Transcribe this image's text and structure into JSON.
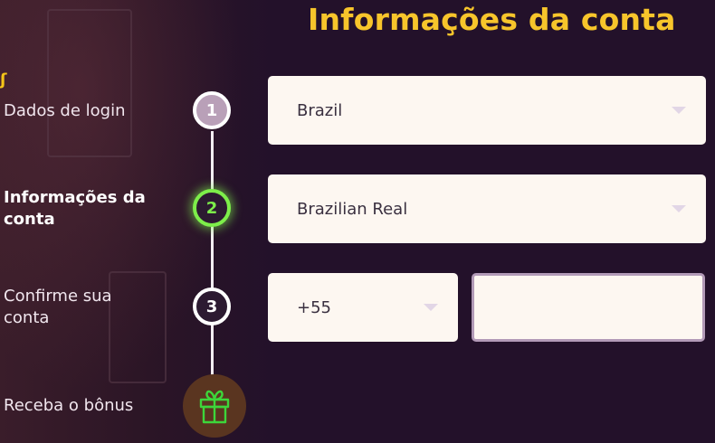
{
  "page": {
    "title": "Informações da conta"
  },
  "steps": [
    {
      "number": "1",
      "label": "Dados de login",
      "state": "completed"
    },
    {
      "number": "2",
      "label": "Informações da conta",
      "state": "active"
    },
    {
      "number": "3",
      "label": "Confirme sua conta",
      "state": "pending"
    },
    {
      "label": "Receba o bônus",
      "icon": "gift-icon"
    }
  ],
  "form": {
    "country": {
      "value": "Brazil"
    },
    "currency": {
      "value": "Brazilian Real"
    },
    "phone_code": {
      "value": "+55"
    },
    "phone_number": {
      "value": ""
    }
  },
  "colors": {
    "accent_title": "#f7c52b",
    "active_step": "#7dee4a",
    "gift": "#3dd63a"
  }
}
